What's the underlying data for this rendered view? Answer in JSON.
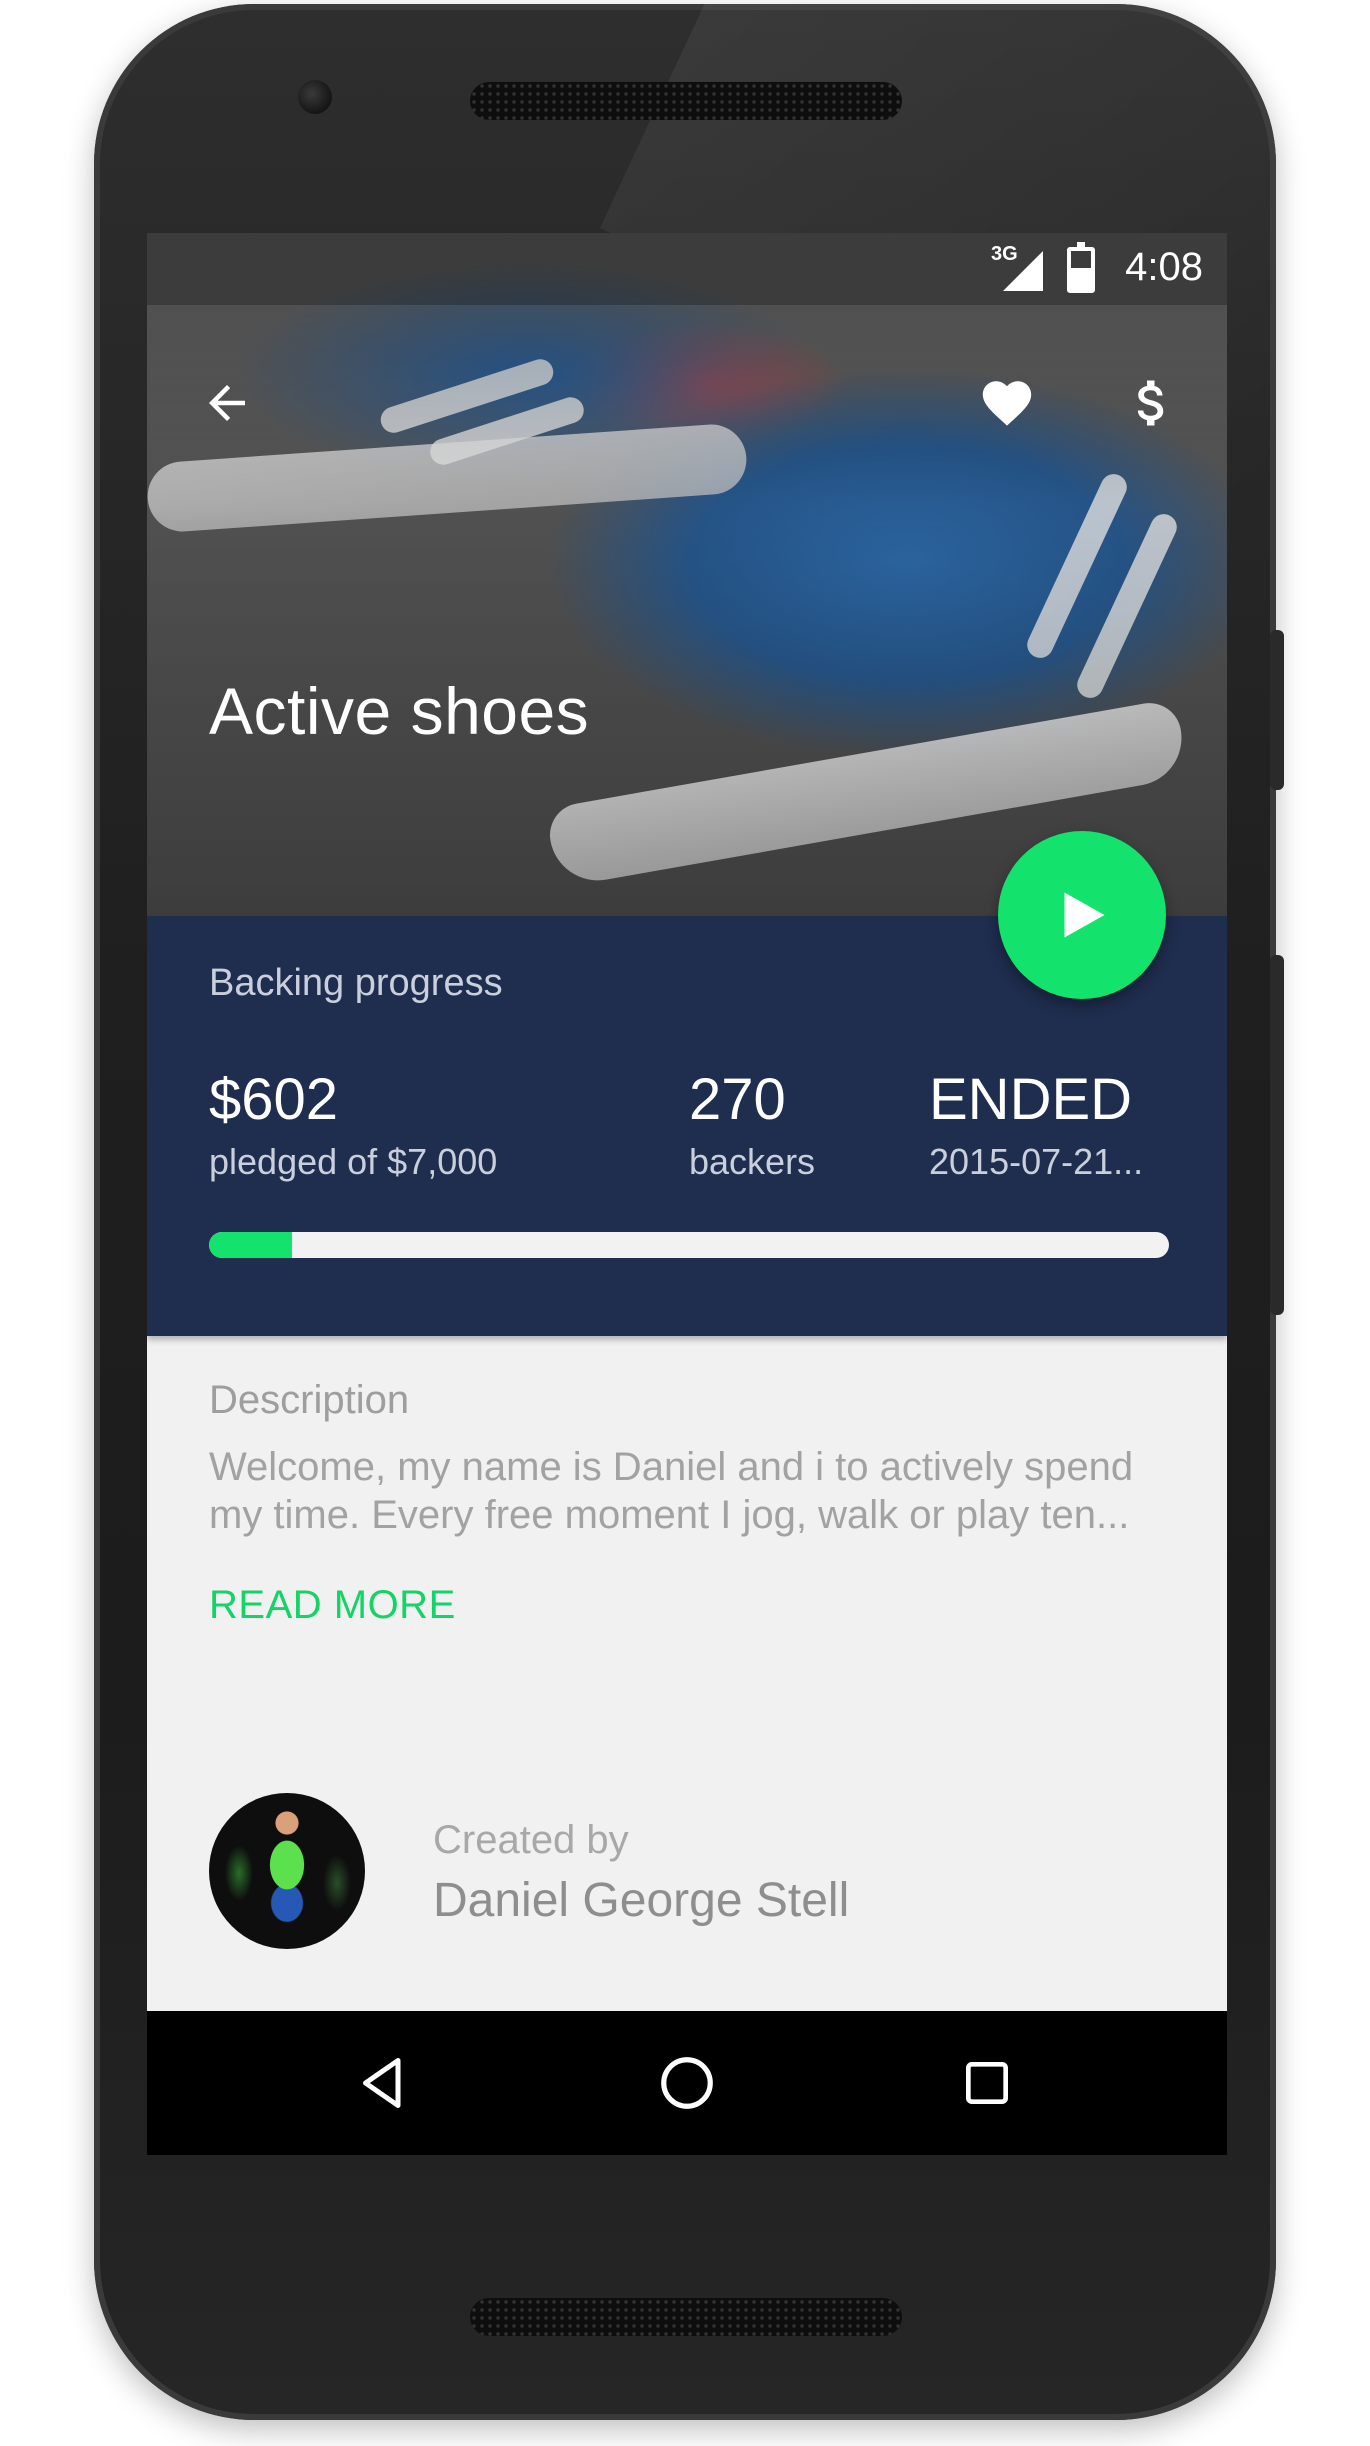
{
  "status_bar": {
    "network": "3G",
    "time": "4:08"
  },
  "app_bar": {
    "back_icon": "arrow-back-icon",
    "favorite_icon": "heart-icon",
    "pledge_icon": "dollar-icon"
  },
  "project": {
    "title": "Active shoes"
  },
  "backing": {
    "label": "Backing progress",
    "pledged_value": "$602",
    "pledged_sub": "pledged of $7,000",
    "backers_value": "270",
    "backers_sub": "backers",
    "status_value": "ENDED",
    "status_sub": "2015-07-21...",
    "progress_fraction": 0.086
  },
  "fab": {
    "icon": "play-icon"
  },
  "description": {
    "label": "Description",
    "text": "Welcome, my name is Daniel and i to actively spend my time. Every free moment I jog, walk or play ten...",
    "read_more": "READ MORE"
  },
  "creator": {
    "label": "Created by",
    "name": "Daniel George Stell"
  },
  "nav_bar": {
    "back": "nav-back-icon",
    "home": "nav-home-icon",
    "recents": "nav-recents-icon"
  },
  "colors": {
    "accent": "#13e26c",
    "panel": "#1f2d4e",
    "background": "#f1f1f1"
  }
}
